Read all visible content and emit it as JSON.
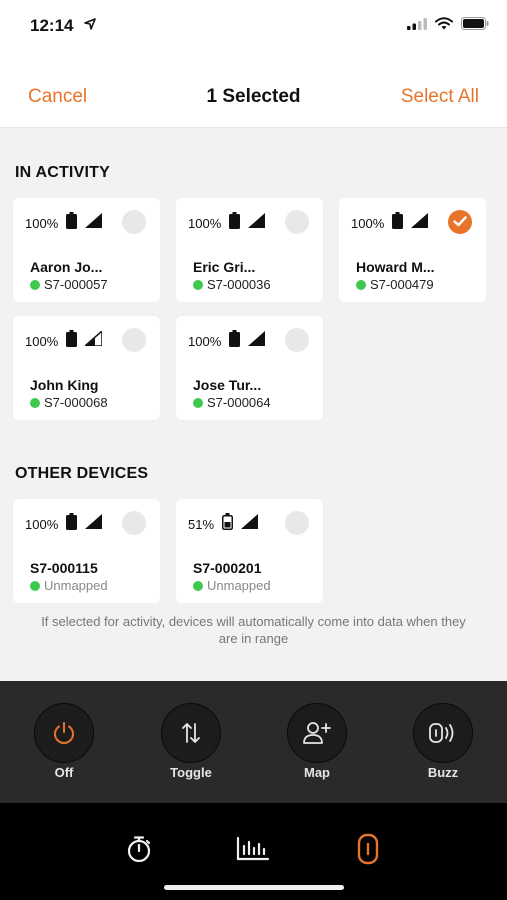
{
  "status_bar": {
    "time": "12:14"
  },
  "nav": {
    "cancel": "Cancel",
    "title": "1 Selected",
    "select_all": "Select All"
  },
  "in_activity": {
    "header": "IN ACTIVITY",
    "devices": [
      {
        "battery": "100%",
        "name": "Aaron Jo...",
        "id": "S7-000057",
        "selected": false
      },
      {
        "battery": "100%",
        "name": "Eric Gri...",
        "id": "S7-000036",
        "selected": false
      },
      {
        "battery": "100%",
        "name": "Howard M...",
        "id": "S7-000479",
        "selected": true
      },
      {
        "battery": "100%",
        "name": "John King",
        "id": "S7-000068",
        "selected": false
      },
      {
        "battery": "100%",
        "name": "Jose Tur...",
        "id": "S7-000064",
        "selected": false
      }
    ]
  },
  "other_devices": {
    "header": "OTHER DEVICES",
    "devices": [
      {
        "battery": "100%",
        "name": "S7-000115",
        "status": "Unmapped",
        "selected": false
      },
      {
        "battery": "51%",
        "name": "S7-000201",
        "status": "Unmapped",
        "selected": false
      }
    ]
  },
  "info": "If selected for activity, devices will automatically come into data when they are in range",
  "actions": [
    {
      "label": "Off",
      "icon": "power-icon"
    },
    {
      "label": "Toggle",
      "icon": "toggle-arrows-icon"
    },
    {
      "label": "Map",
      "icon": "add-person-icon"
    },
    {
      "label": "Buzz",
      "icon": "buzz-icon"
    }
  ],
  "tabs": [
    {
      "icon": "stopwatch-icon",
      "active": false
    },
    {
      "icon": "bar-chart-icon",
      "active": false
    },
    {
      "icon": "device-icon",
      "active": true
    }
  ],
  "colors": {
    "accent": "#e8742b",
    "online": "#3ec94e",
    "action_bar": "#2a2a2a",
    "tab_bar": "#000000"
  }
}
